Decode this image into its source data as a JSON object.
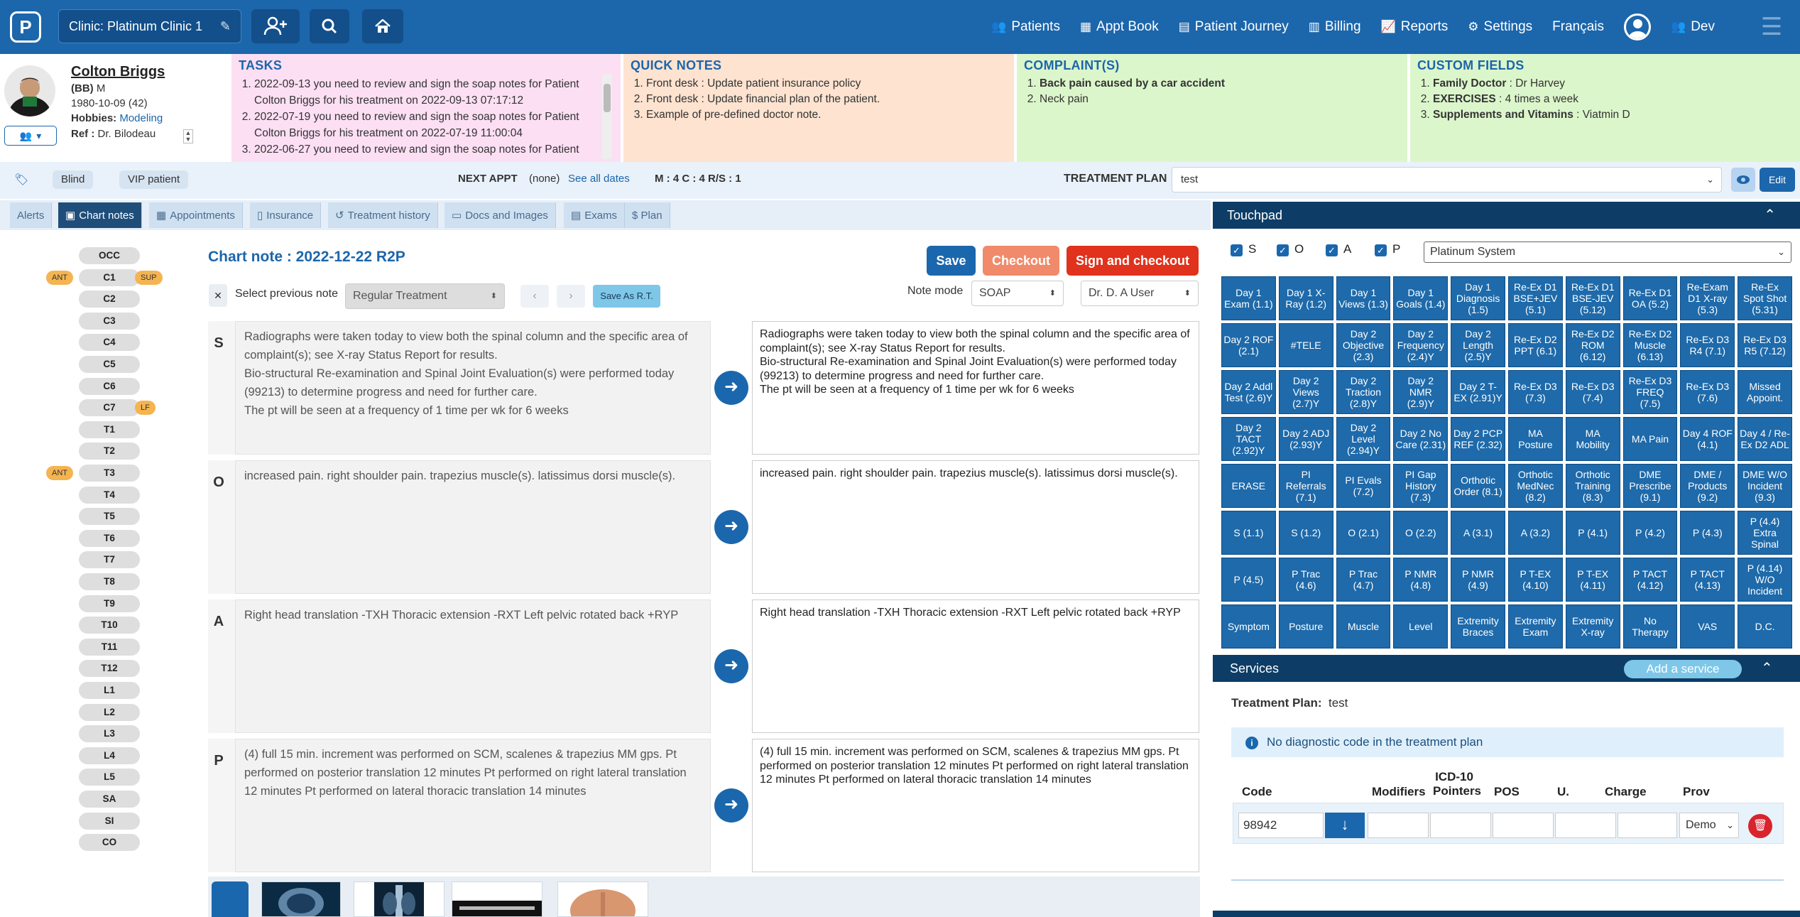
{
  "topbar": {
    "logo": "P",
    "clinic": "Clinic: Platinum Clinic 1",
    "nav": [
      {
        "label": "Patients",
        "icon": "users-icon"
      },
      {
        "label": "Appt Book",
        "icon": "calendar-icon"
      },
      {
        "label": "Patient Journey",
        "icon": "journey-icon"
      },
      {
        "label": "Billing",
        "icon": "billing-icon"
      },
      {
        "label": "Reports",
        "icon": "chart-icon"
      },
      {
        "label": "Settings",
        "icon": "gears-icon"
      }
    ],
    "language": "Français",
    "user": "Dev"
  },
  "patient": {
    "name": "Colton Briggs",
    "nick": "(BB)",
    "sex": "M",
    "dob": "1980-10-09 (42)",
    "hobbies_label": "Hobbies:",
    "hobbies": "Modeling",
    "ref_label": "Ref :",
    "ref": "Dr. Bilodeau"
  },
  "tasks": {
    "title": "TASKS",
    "items": [
      "2022-09-13  you need to review and sign the soap notes for Patient Colton Briggs for his treatment on 2022-09-13 07:17:12",
      "2022-07-19  you need to review and sign the soap notes for Patient Colton Briggs for his treatment on 2022-07-19 11:00:04",
      "2022-06-27  you need to review and sign the soap notes for Patient"
    ]
  },
  "quick_notes": {
    "title": "QUICK NOTES",
    "items": [
      "Front desk : Update patient insurance policy",
      "Front desk : Update financial plan of the patient.",
      "Example of pre-defined doctor note."
    ]
  },
  "complaints": {
    "title": "COMPLAINT(S)",
    "items": [
      "Back pain caused by a car accident",
      "Neck pain"
    ]
  },
  "custom_fields": {
    "title": "CUSTOM FIELDS",
    "items": [
      {
        "k": "Family Doctor",
        "v": " : Dr Harvey"
      },
      {
        "k": "EXERCISES",
        "v": " : 4 times a week"
      },
      {
        "k": "Supplements and Vitamins",
        "v": " : Viatmin D"
      }
    ]
  },
  "infobar": {
    "tags": [
      "Blind",
      "VIP patient"
    ],
    "next_appt_label": "NEXT APPT",
    "next_appt_value": "(none)",
    "see_all": "See all dates",
    "mcrs": "M : 4 C : 4 R/S : 1",
    "tp_label": "TREATMENT PLAN",
    "tp_value": "test",
    "edit": "Edit"
  },
  "tabs": [
    {
      "label": "Alerts",
      "icon": ""
    },
    {
      "label": "Chart notes",
      "icon": "note-icon"
    },
    {
      "label": "Appointments",
      "icon": "calendar-icon"
    },
    {
      "label": "Insurance",
      "icon": "document-icon"
    },
    {
      "label": "Treatment history",
      "icon": "history-icon"
    },
    {
      "label": "Docs and Images",
      "icon": "folder-icon"
    },
    {
      "label": "Exams",
      "icon": "clipboard-icon"
    },
    {
      "label": "$ Plan",
      "icon": ""
    }
  ],
  "spine": {
    "vertebrae": [
      "OCC",
      "C1",
      "C2",
      "C3",
      "C4",
      "C5",
      "C6",
      "C7",
      "T1",
      "T2",
      "T3",
      "T4",
      "T5",
      "T6",
      "T7",
      "T8",
      "T9",
      "T10",
      "T11",
      "T12",
      "L1",
      "L2",
      "L3",
      "L4",
      "L5",
      "SA",
      "SI",
      "CO"
    ],
    "labels": [
      {
        "v": "C1",
        "left": "ANT",
        "right": "SUP"
      },
      {
        "v": "C7",
        "left": "",
        "right": "LF"
      },
      {
        "v": "T3",
        "left": "ANT",
        "right": ""
      }
    ]
  },
  "chart_note": {
    "title": "Chart note : 2022-12-22 R2P",
    "save": "Save",
    "checkout": "Checkout",
    "sign_checkout": "Sign and checkout",
    "select_prev": "Select previous note",
    "regular": "Regular Treatment",
    "save_as_rt": "Save As R.T.",
    "note_mode_label": "Note mode",
    "note_mode": "SOAP",
    "provider": "Dr. D. A User",
    "sections": [
      {
        "letter": "S",
        "left": "Radiographs were taken today to view both the spinal column and the specific area of complaint(s); see X-ray Status Report for results.\nBio-structural Re-examination and Spinal Joint Evaluation(s) were performed today (99213) to determine progress and need for further care.\nThe pt will be seen at a frequency of 1 time per wk for 6 weeks",
        "right": "Radiographs were taken today to view both the spinal column and the specific area of complaint(s); see X-ray Status Report for results.\nBio-structural Re-examination and Spinal Joint Evaluation(s) were performed today (99213) to determine progress and need for further care.\nThe pt will be seen at a frequency of 1 time per wk for 6 weeks"
      },
      {
        "letter": "O",
        "left": "increased pain. right shoulder pain. trapezius muscle(s). latissimus dorsi muscle(s).",
        "right": "increased pain. right shoulder pain. trapezius muscle(s). latissimus dorsi muscle(s)."
      },
      {
        "letter": "A",
        "left": "Right head translation -TXH Thoracic extension -RXT Left pelvic rotated back +RYP",
        "right": "Right head translation -TXH Thoracic extension -RXT Left pelvic rotated back +RYP"
      },
      {
        "letter": "P",
        "left": "(4) full 15 min. increment was performed on SCM, scalenes & trapezius MM gps. Pt performed on posterior translation 12 minutes Pt performed on right lateral translation 12 minutes Pt performed on lateral thoracic translation 14 minutes",
        "right": "(4) full 15 min. increment was performed on SCM, scalenes & trapezius MM gps. Pt performed on posterior translation 12 minutes Pt performed on right lateral translation 12 minutes Pt performed on lateral thoracic translation 14 minutes"
      }
    ]
  },
  "touchpad": {
    "title": "Touchpad",
    "checks": [
      "S",
      "O",
      "A",
      "P"
    ],
    "system": "Platinum System",
    "cells": [
      "Day 1 Exam (1.1)",
      "Day 1 X-Ray (1.2)",
      "Day 1 Views (1.3)",
      "Day 1 Goals (1.4)",
      "Day 1 Diagnosis (1.5)",
      "Re-Ex D1 BSE+JEV (5.1)",
      "Re-Ex D1 BSE-JEV (5.12)",
      "Re-Ex D1 OA (5.2)",
      "Re-Exam D1 X-ray (5.3)",
      "Re-Ex Spot Shot (5.31)",
      "Day 2 ROF (2.1)",
      "#TELE",
      "Day 2 Objective (2.3)",
      "Day 2 Frequency (2.4)Y",
      "Day 2 Length (2.5)Y",
      "Re-Ex D2 PPT (6.1)",
      "Re-Ex D2 ROM (6.12)",
      "Re-Ex D2 Muscle (6.13)",
      "Re-Ex D3 R4 (7.1)",
      "Re-Ex D3 R5 (7.12)",
      "Day 2 Addl Test (2.6)Y",
      "Day 2 Views (2.7)Y",
      "Day 2 Traction (2.8)Y",
      "Day 2 NMR (2.9)Y",
      "Day 2 T-EX (2.91)Y",
      "Re-Ex D3 (7.3)",
      "Re-Ex D3 (7.4)",
      "Re-Ex D3 FREQ (7.5)",
      "Re-Ex D3 (7.6)",
      "Missed Appoint.",
      "Day 2 TACT (2.92)Y",
      "Day 2 ADJ (2.93)Y",
      "Day 2 Level (2.94)Y",
      "Day 2 No Care (2.31)",
      "Day 2 PCP REF (2.32)",
      "MA Posture",
      "MA Mobility",
      "MA Pain",
      "Day 4 ROF (4.1)",
      "Day 4 / Re-Ex D2 ADL",
      "ERASE",
      "PI Referrals (7.1)",
      "PI Evals (7.2)",
      "PI Gap History (7.3)",
      "Orthotic Order (8.1)",
      "Orthotic MedNec (8.2)",
      "Orthotic Training (8.3)",
      "DME Prescribe (9.1)",
      "DME / Products (9.2)",
      "DME W/O Incident (9.3)",
      "S (1.1)",
      "S (1.2)",
      "O (2.1)",
      "O (2.2)",
      "A (3.1)",
      "A (3.2)",
      "P (4.1)",
      "P (4.2)",
      "P (4.3)",
      "P (4.4) Extra Spinal",
      "P (4.5)",
      "P Trac (4.6)",
      "P Trac (4.7)",
      "P NMR (4.8)",
      "P NMR (4.9)",
      "P T-EX (4.10)",
      "P T-EX (4.11)",
      "P TACT (4.12)",
      "P TACT (4.13)",
      "P (4.14) W/O Incident",
      "Symptom",
      "Posture",
      "Muscle",
      "Level",
      "Extremity Braces",
      "Extremity Exam",
      "Extremity X-ray",
      "No Therapy",
      "VAS",
      "D.C."
    ]
  },
  "services": {
    "title": "Services",
    "add": "Add a service",
    "tp_label": "Treatment Plan:",
    "tp_value": "test",
    "no_diag": "No diagnostic code in the treatment plan",
    "headers": [
      "Code",
      "Modifiers",
      "ICD-10 Pointers",
      "POS",
      "U.",
      "Charge",
      "Prov"
    ],
    "row": {
      "code": "98942",
      "prov": "Demo"
    }
  }
}
